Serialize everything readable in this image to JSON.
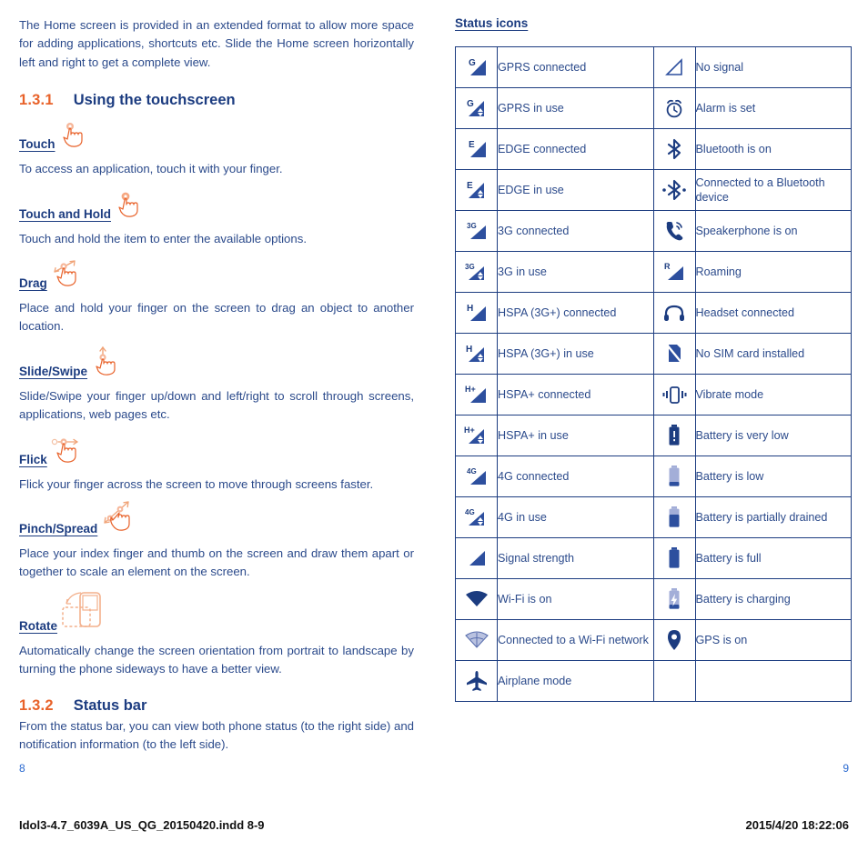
{
  "colors": {
    "body_text": "#2b4a8b",
    "heading": "#1c3c80",
    "accent_orange": "#e8622a",
    "icon_blue": "#2d4f9e",
    "icon_blue_dark": "#1c3c80",
    "icon_blue_light": "#a3aed8",
    "page_number": "#2b6ad0"
  },
  "left_column": {
    "intro_paragraph": "The Home screen is provided in an extended format to allow more space for adding applications, shortcuts etc. Slide the Home screen horizontally left and right to get a complete view.",
    "section_1": {
      "number": "1.3.1",
      "title": "Using the touchscreen"
    },
    "gestures": [
      {
        "label": "Touch",
        "icon": "hand-touch-icon",
        "description": "To access an application, touch it with your finger."
      },
      {
        "label": "Touch and Hold",
        "icon": "hand-touch-hold-icon",
        "description": "Touch and hold the item to enter the available options."
      },
      {
        "label": "Drag",
        "icon": "hand-drag-icon",
        "description": "Place and hold your finger on the screen to drag an object to another location."
      },
      {
        "label": "Slide/Swipe",
        "icon": "hand-slide-swipe-icon",
        "description": "Slide/Swipe your finger up/down and left/right to scroll through screens, applications, web pages etc."
      },
      {
        "label": "Flick",
        "icon": "hand-flick-icon",
        "description": "Flick your finger across the screen to move through screens faster."
      },
      {
        "label": "Pinch/Spread",
        "icon": "hand-pinch-spread-icon",
        "description": "Place your index finger and thumb on the screen and draw them apart or together to scale an element on the screen."
      },
      {
        "label": "Rotate",
        "icon": "phone-rotate-icon",
        "description": "Automatically change the screen orientation from portrait to landscape by turning the phone sideways to have a better view."
      }
    ],
    "section_2": {
      "number": "1.3.2",
      "title": "Status bar",
      "description": "From the status bar, you can view both phone status (to the right side) and notification information (to the left side)."
    }
  },
  "right_column": {
    "heading": "Status icons",
    "table_rows": [
      {
        "left_icon": "signal-gprs-connected-icon",
        "left_label": "GPRS connected",
        "right_icon": "signal-none-icon",
        "right_label": "No signal"
      },
      {
        "left_icon": "signal-gprs-inuse-icon",
        "left_label": "GPRS in use",
        "right_icon": "alarm-clock-icon",
        "right_label": "Alarm is set"
      },
      {
        "left_icon": "signal-edge-connected-icon",
        "left_label": "EDGE connected",
        "right_icon": "bluetooth-icon",
        "right_label": "Bluetooth is on"
      },
      {
        "left_icon": "signal-edge-inuse-icon",
        "left_label": "EDGE in use",
        "right_icon": "bluetooth-connected-icon",
        "right_label": "Connected to a Bluetooth device"
      },
      {
        "left_icon": "signal-3g-connected-icon",
        "left_label": "3G connected",
        "right_icon": "speakerphone-icon",
        "right_label": "Speakerphone is on"
      },
      {
        "left_icon": "signal-3g-inuse-icon",
        "left_label": "3G in use",
        "right_icon": "roaming-icon",
        "right_label": "Roaming"
      },
      {
        "left_icon": "signal-hspa-connected-icon",
        "left_label": "HSPA (3G+) connected",
        "right_icon": "headset-icon",
        "right_label": "Headset connected"
      },
      {
        "left_icon": "signal-hspa-inuse-icon",
        "left_label": "HSPA (3G+) in use",
        "right_icon": "no-sim-card-icon",
        "right_label": "No SIM card installed"
      },
      {
        "left_icon": "signal-hspaplus-connected-icon",
        "left_label": "HSPA+ connected",
        "right_icon": "vibrate-mode-icon",
        "right_label": "Vibrate mode"
      },
      {
        "left_icon": "signal-hspaplus-inuse-icon",
        "left_label": "HSPA+ in use",
        "right_icon": "battery-very-low-icon",
        "right_label": "Battery is very low"
      },
      {
        "left_icon": "signal-4g-connected-icon",
        "left_label": "4G connected",
        "right_icon": "battery-low-icon",
        "right_label": "Battery is low"
      },
      {
        "left_icon": "signal-4g-inuse-icon",
        "left_label": "4G in use",
        "right_icon": "battery-partially-drained-icon",
        "right_label": "Battery is partially drained"
      },
      {
        "left_icon": "signal-strength-icon",
        "left_label": "Signal strength",
        "right_icon": "battery-full-icon",
        "right_label": "Battery is full"
      },
      {
        "left_icon": "wifi-on-icon",
        "left_label": "Wi-Fi is on",
        "right_icon": "battery-charging-icon",
        "right_label": "Battery is charging"
      },
      {
        "left_icon": "wifi-connected-icon",
        "left_label": "Connected to a Wi-Fi network",
        "right_icon": "gps-icon",
        "right_label": "GPS is on"
      },
      {
        "left_icon": "airplane-mode-icon",
        "left_label": "Airplane mode",
        "right_icon": "",
        "right_label": ""
      }
    ]
  },
  "footer": {
    "page_left": "8",
    "page_right": "9",
    "imprint_left": "Idol3-4.7_6039A_US_QG_20150420.indd   8-9",
    "imprint_right": "2015/4/20   18:22:06"
  }
}
